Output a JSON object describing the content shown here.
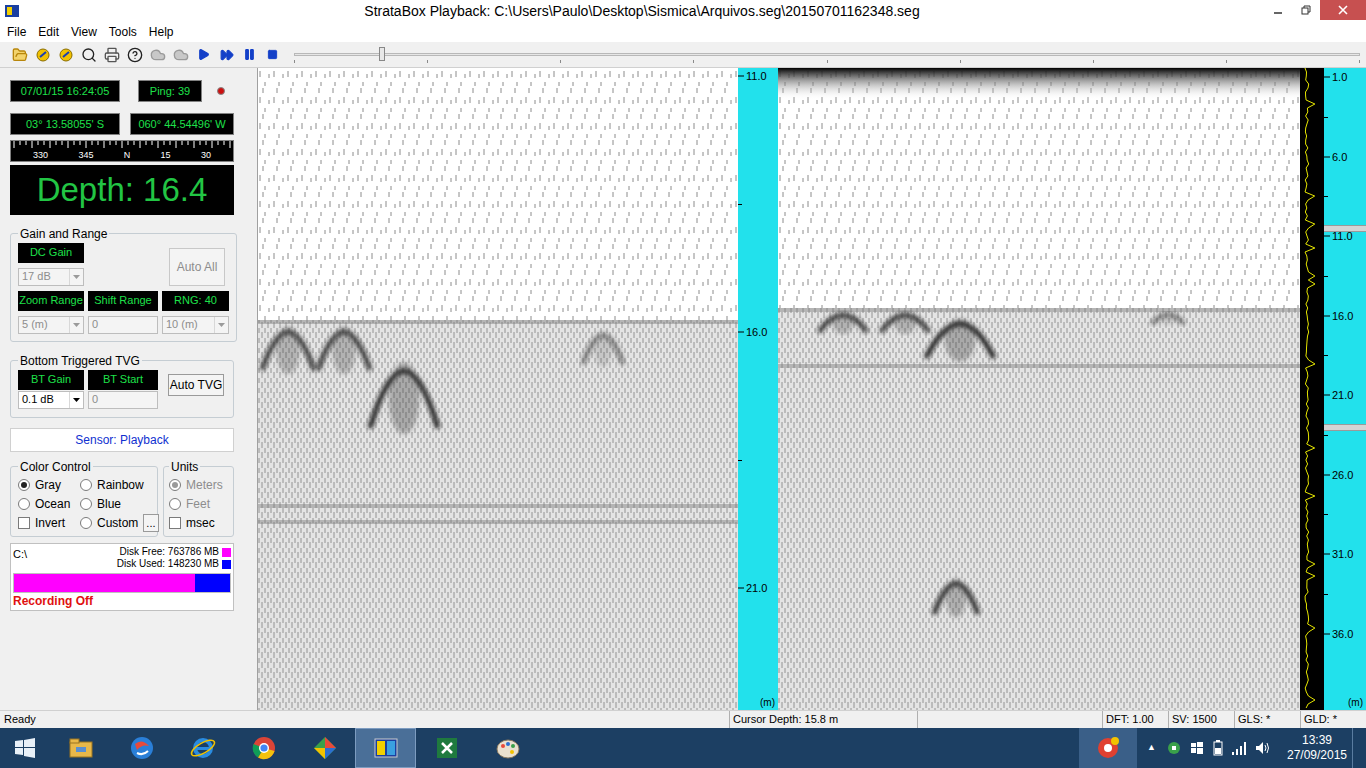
{
  "window": {
    "title": "StrataBox Playback: C:\\Users\\Paulo\\Desktop\\Sismica\\Arquivos.seg\\20150701162348.seg",
    "controls": [
      {
        "kind": "minimize"
      },
      {
        "kind": "restore"
      },
      {
        "kind": "close"
      }
    ]
  },
  "menu": [
    "File",
    "Edit",
    "View",
    "Tools",
    "Help"
  ],
  "toolbar": {
    "buttons": [
      {
        "kind": "open",
        "disabled": false
      },
      {
        "kind": "sonar",
        "disabled": false
      },
      {
        "kind": "sonar",
        "disabled": false
      },
      {
        "kind": "zoom",
        "disabled": false
      },
      {
        "kind": "print",
        "disabled": false
      },
      {
        "kind": "help",
        "disabled": false
      },
      {
        "kind": "cloud",
        "disabled": true
      },
      {
        "kind": "cloud",
        "disabled": true
      },
      {
        "kind": "play",
        "disabled": false
      },
      {
        "kind": "fast-forward",
        "disabled": false
      },
      {
        "kind": "pause",
        "disabled": false
      },
      {
        "kind": "stop",
        "disabled": false
      }
    ],
    "slider": {
      "level": 0.08
    }
  },
  "status_panel": {
    "datetime": "07/01/15 16:24:05",
    "ping": "Ping: 39",
    "recording_dot_color": "#cc1010",
    "latitude": "03° 13.58055' S",
    "longitude": "060° 44.54496' W",
    "compass": [
      "330",
      "345",
      "N",
      "15",
      "30"
    ],
    "depth": "Depth: 16.4"
  },
  "gain_and_range": {
    "title": "Gain and Range",
    "dc_gain": {
      "label": "DC Gain",
      "value": "17 dB",
      "kind": "select",
      "disabled": true
    },
    "auto_all": {
      "label": "Auto All",
      "disabled": true
    },
    "fields": [
      {
        "label": "Zoom Range",
        "value": "5 (m)",
        "kind": "select",
        "disabled": true
      },
      {
        "label": "Shift Range",
        "value": "0",
        "kind": "input",
        "disabled": true
      },
      {
        "label": "RNG: 40",
        "value": "10 (m)",
        "kind": "select",
        "disabled": true
      }
    ]
  },
  "tvg": {
    "title": "Bottom Triggered TVG",
    "fields": [
      {
        "label": "BT Gain",
        "value": "0.1 dB",
        "kind": "select",
        "disabled": false
      },
      {
        "label": "BT Start",
        "value": "0",
        "kind": "input",
        "disabled": true
      }
    ],
    "auto_tvg": {
      "label": "Auto TVG",
      "disabled": false
    }
  },
  "sensor": "Sensor: Playback",
  "color_control": {
    "title": "Color Control",
    "options": [
      {
        "label": "Gray",
        "kind": "radio",
        "selected": true
      },
      {
        "label": "Rainbow",
        "kind": "radio",
        "selected": false
      },
      {
        "label": "Ocean",
        "kind": "radio",
        "selected": false
      },
      {
        "label": "Blue",
        "kind": "radio",
        "selected": false
      },
      {
        "label": "Invert",
        "kind": "checkbox",
        "selected": false
      },
      {
        "label": "Custom",
        "kind": "radio",
        "selected": false
      }
    ],
    "more_button": "..."
  },
  "units": {
    "title": "Units",
    "options": [
      {
        "label": "Meters",
        "kind": "radio",
        "selected": true,
        "disabled": true
      },
      {
        "label": "Feet",
        "kind": "radio",
        "selected": false,
        "disabled": true
      },
      {
        "label": "msec",
        "kind": "checkbox",
        "selected": false,
        "disabled": false
      }
    ]
  },
  "disk": {
    "drive": "C:\\",
    "free": "Disk Free: 763786 MB",
    "used": "Disk Used: 148230 MB",
    "free_color": "#ff00ff",
    "used_color": "#0000ff",
    "level": 0.84,
    "recording": "Recording Off"
  },
  "rulers": [
    {
      "labels": [
        "11.0",
        "16.0",
        "21.0"
      ],
      "unit": "(m)",
      "markers": []
    },
    {
      "labels": [
        "1.0",
        "6.0",
        "11.0",
        "16.0",
        "21.0",
        "26.0",
        "31.0",
        "36.0"
      ],
      "unit": "(m)",
      "markers": [
        10.5,
        23.0
      ]
    }
  ],
  "status_bar": {
    "message": "Ready",
    "fields": [
      "Cursor Depth: 15.8 m",
      "DFT: 1.00",
      "SV: 1500",
      "GLS: *",
      "GLD: *"
    ]
  },
  "taskbar": {
    "apps": [
      {
        "kind": "explorer",
        "active": false
      },
      {
        "kind": "browser",
        "active": false
      },
      {
        "kind": "ie",
        "active": false
      },
      {
        "kind": "chrome",
        "active": false
      },
      {
        "kind": "maps",
        "active": false
      },
      {
        "kind": "stratabox",
        "active": true
      },
      {
        "kind": "excel",
        "active": false
      },
      {
        "kind": "paint",
        "active": false
      }
    ],
    "tray": {
      "show_hidden": "▲",
      "time": "13:39",
      "date": "27/09/2015"
    }
  }
}
